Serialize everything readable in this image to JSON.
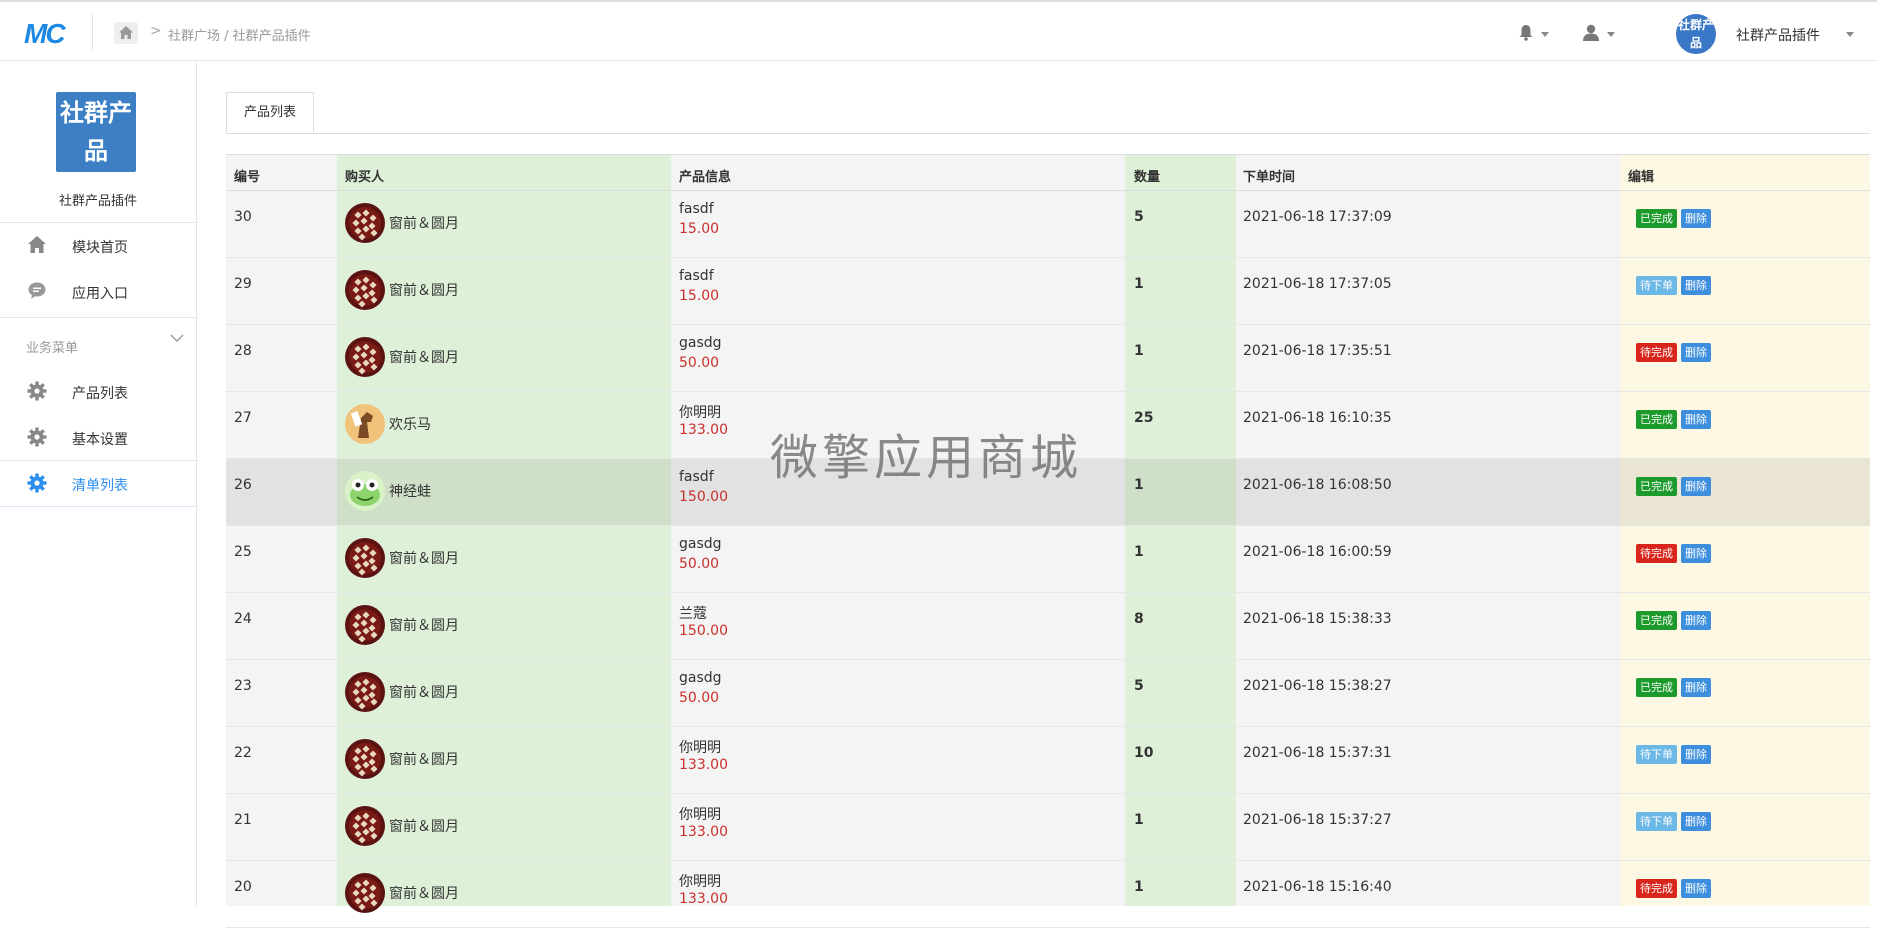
{
  "header": {
    "logo": "MC",
    "breadcrumb": "社群广场 / 社群产品插件",
    "avatar_text": "社群产品",
    "user_name": "社群产品插件"
  },
  "sidebar": {
    "app_logo_text": "社群产品",
    "app_name": "社群产品插件",
    "items": [
      {
        "label": "模块首页",
        "icon": "home-icon"
      },
      {
        "label": "应用入口",
        "icon": "chat-icon"
      }
    ],
    "group_label": "业务菜单",
    "group_items": [
      {
        "label": "产品列表",
        "icon": "gear-icon"
      },
      {
        "label": "基本设置",
        "icon": "gear-icon"
      },
      {
        "label": "清单列表",
        "icon": "gear-icon",
        "active": true
      }
    ]
  },
  "tabs": [
    {
      "label": "产品列表"
    }
  ],
  "table": {
    "columns": [
      "编号",
      "购买人",
      "产品信息",
      "数量",
      "下单时间",
      "编辑"
    ],
    "delete_label": "删除",
    "rows": [
      {
        "id": "30",
        "buyer": "窗前＆圆月",
        "avatar": "avatar-pattern",
        "product": "fasdf",
        "price": "15.00",
        "qty": "5",
        "time": "2021-06-18 17:37:09",
        "status": "已完成",
        "status_color": "#1c9b2c"
      },
      {
        "id": "29",
        "buyer": "窗前＆圆月",
        "avatar": "avatar-pattern",
        "product": "fasdf",
        "price": "15.00",
        "qty": "1",
        "time": "2021-06-18 17:37:05",
        "status": "待下单",
        "status_color": "#6bb8e6"
      },
      {
        "id": "28",
        "buyer": "窗前＆圆月",
        "avatar": "avatar-pattern",
        "product": "gasdg",
        "price": "50.00",
        "qty": "1",
        "time": "2021-06-18 17:35:51",
        "status": "待完成",
        "status_color": "#d9261c"
      },
      {
        "id": "27",
        "buyer": "欢乐马",
        "avatar": "avatar-horse",
        "product": "你明明",
        "price": "133.00",
        "qty": "25",
        "time": "2021-06-18 16:10:35",
        "status": "已完成",
        "status_color": "#1c9b2c"
      },
      {
        "id": "26",
        "buyer": "神经蛙",
        "avatar": "avatar-frog",
        "product": "fasdf",
        "price": "150.00",
        "qty": "1",
        "time": "2021-06-18 16:08:50",
        "status": "已完成",
        "status_color": "#1c9b2c",
        "highlight": true
      },
      {
        "id": "25",
        "buyer": "窗前＆圆月",
        "avatar": "avatar-pattern",
        "product": "gasdg",
        "price": "50.00",
        "qty": "1",
        "time": "2021-06-18 16:00:59",
        "status": "待完成",
        "status_color": "#d9261c"
      },
      {
        "id": "24",
        "buyer": "窗前＆圆月",
        "avatar": "avatar-pattern",
        "product": "兰蔻",
        "price": "150.00",
        "qty": "8",
        "time": "2021-06-18 15:38:33",
        "status": "已完成",
        "status_color": "#1c9b2c"
      },
      {
        "id": "23",
        "buyer": "窗前＆圆月",
        "avatar": "avatar-pattern",
        "product": "gasdg",
        "price": "50.00",
        "qty": "5",
        "time": "2021-06-18 15:38:27",
        "status": "已完成",
        "status_color": "#1c9b2c"
      },
      {
        "id": "22",
        "buyer": "窗前＆圆月",
        "avatar": "avatar-pattern",
        "product": "你明明",
        "price": "133.00",
        "qty": "10",
        "time": "2021-06-18 15:37:31",
        "status": "待下单",
        "status_color": "#6bb8e6"
      },
      {
        "id": "21",
        "buyer": "窗前＆圆月",
        "avatar": "avatar-pattern",
        "product": "你明明",
        "price": "133.00",
        "qty": "1",
        "time": "2021-06-18 15:37:27",
        "status": "待下单",
        "status_color": "#6bb8e6"
      },
      {
        "id": "20",
        "buyer": "窗前＆圆月",
        "avatar": "avatar-pattern",
        "product": "你明明",
        "price": "133.00",
        "qty": "1",
        "time": "2021-06-18 15:16:40",
        "status": "待完成",
        "status_color": "#d9261c"
      }
    ]
  },
  "watermark": "微擎应用商城"
}
